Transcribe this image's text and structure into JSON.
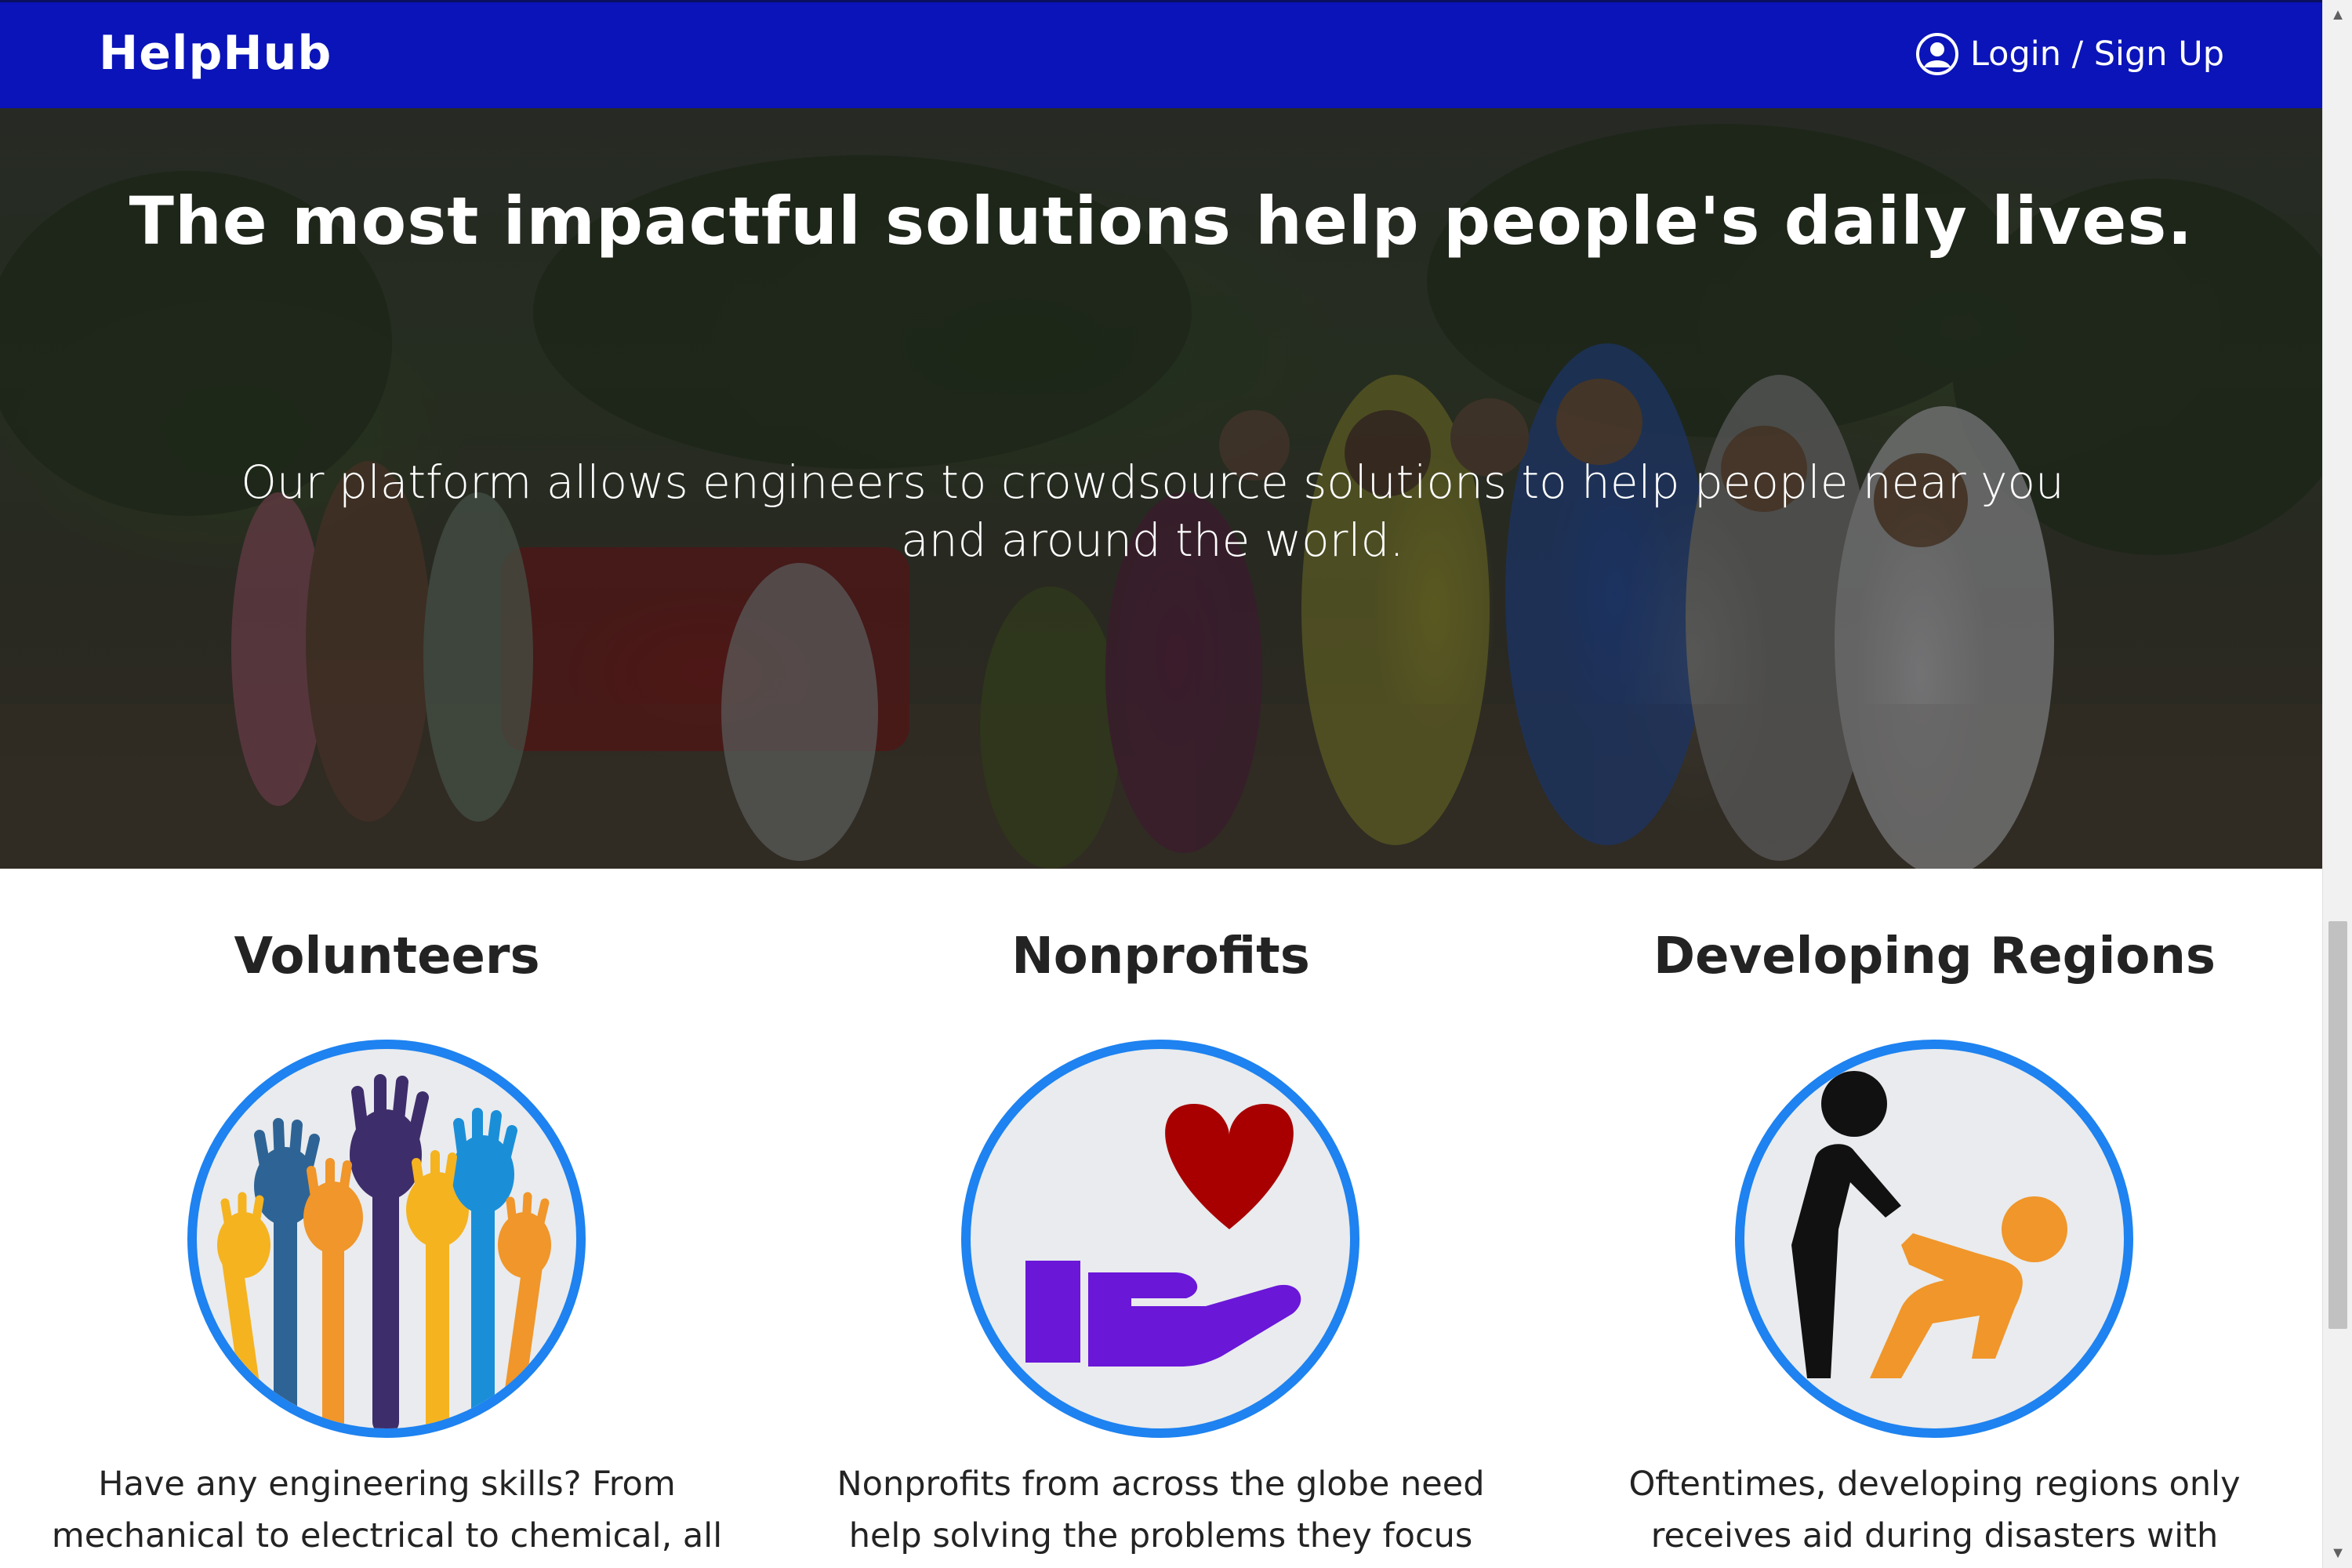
{
  "navbar": {
    "brand": "HelpHub",
    "login_label": "Login / Sign Up",
    "login_icon": "user-circle-icon",
    "background_color": "#0a14b8"
  },
  "hero": {
    "title": "The most impactful solutions help people's daily lives.",
    "subtitle": "Our platform allows engineers to crowdsource solutions to help people near you and around the world.",
    "image": "group-of-volunteers-photo"
  },
  "features": [
    {
      "title": "Volunteers",
      "icon": "raised-hands-icon",
      "text": "Have any engineering skills? From mechanical to electrical to chemical, all"
    },
    {
      "title": "Nonprofits",
      "icon": "heart-in-hand-icon",
      "text": "Nonprofits from across the globe need help solving the problems they focus on. Using"
    },
    {
      "title": "Developing Regions",
      "icon": "helping-person-up-icon",
      "text": "Oftentimes, developing regions only receives aid during disasters with media"
    }
  ],
  "colors": {
    "accent": "#1e82f0",
    "heart": "#a80000",
    "hand": "#6a17d8",
    "orange": "#f0962a"
  }
}
